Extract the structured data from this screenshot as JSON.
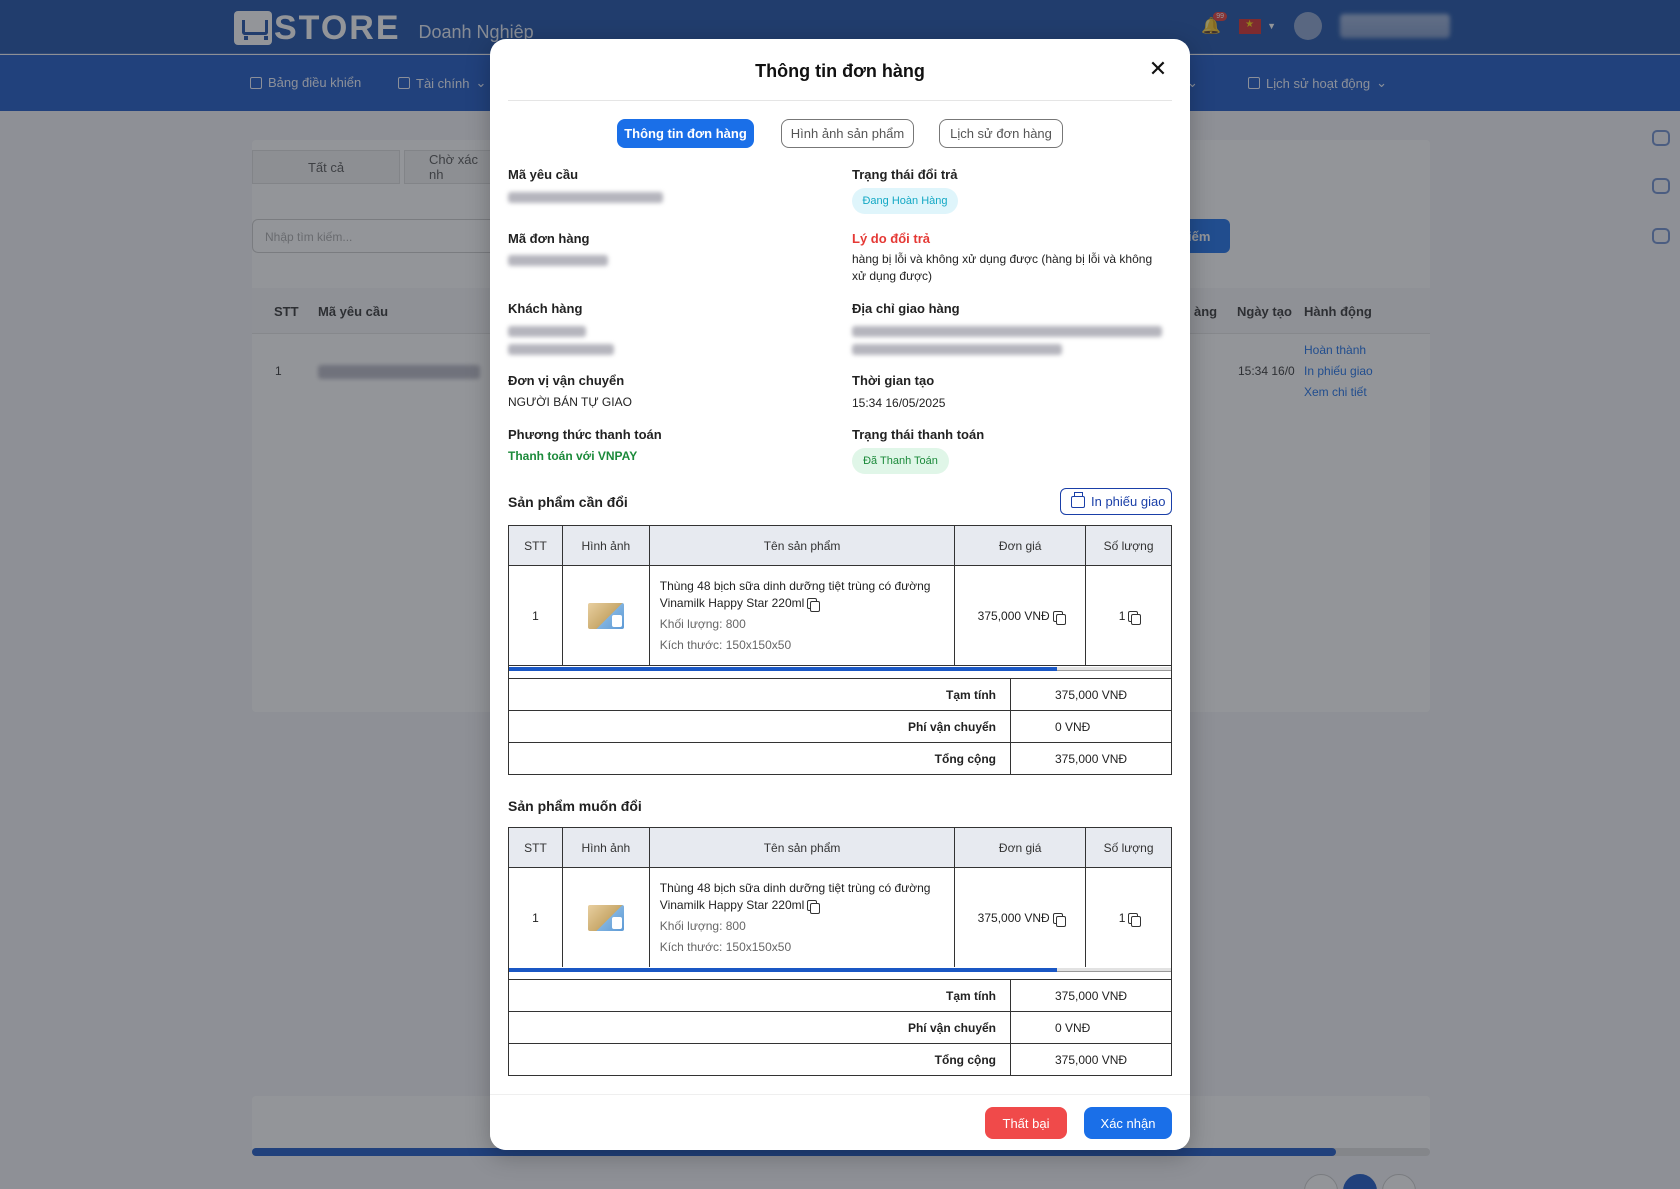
{
  "header": {
    "logo_text": "STORE",
    "logo_sub": "Doanh Nghiệp",
    "notif_count": "99"
  },
  "nav": {
    "dashboard": "Bảng điều khiển",
    "finance": "Tài chính",
    "history": "Lịch sử hoạt động"
  },
  "bg": {
    "tab_all": "Tất cả",
    "tab_pending": "Chờ xác nh",
    "search_placeholder": "Nhập tìm kiếm...",
    "search_btn": "iếm",
    "col_stt": "STT",
    "col_code": "Mã yêu cầu",
    "col_partial": "àng",
    "col_created": "Ngày tạo",
    "col_action": "Hành động",
    "row_stt": "1",
    "row_time": "15:34 16/0",
    "action_complete": "Hoàn thành",
    "action_print": "In phiếu giao",
    "action_detail": "Xem chi tiết",
    "page_current": "1",
    "scroll_fraction": 0.92
  },
  "modal": {
    "title": "Thông tin đơn hàng",
    "tabs": [
      "Thông tin đơn hàng",
      "Hình ảnh sản phẩm",
      "Lịch sử đơn hàng"
    ],
    "fields": {
      "request_code_label": "Mã yêu cầu",
      "request_code_value": "",
      "order_code_label": "Mã đơn hàng",
      "order_code_value": "",
      "customer_label": "Khách hàng",
      "customer_value": "",
      "shipping_unit_label": "Đơn vị vận chuyển",
      "shipping_unit_value": "NGƯỜI BÁN TỰ GIAO",
      "payment_method_label": "Phương thức thanh toán",
      "payment_method_value": "Thanh toán với VNPAY",
      "return_status_label": "Trạng thái đổi trả",
      "return_status_value": "Đang Hoàn Hàng",
      "return_reason_label": "Lý do đổi trả",
      "return_reason_value": "hàng bị lỗi và không xử dụng được (hàng bị lỗi và không xử dụng được)",
      "address_label": "Địa chỉ giao hàng",
      "address_value": "",
      "created_time_label": "Thời gian tạo",
      "created_time_value": "15:34 16/05/2025",
      "payment_status_label": "Trạng thái thanh toán",
      "payment_status_value": "Đã Thanh Toán"
    },
    "section_exchange": "Sản phẩm cần đổi",
    "section_wanted": "Sản phẩm muốn đổi",
    "print_btn": "In phiếu giao",
    "table_headers": [
      "STT",
      "Hình ảnh",
      "Tên sản phẩm",
      "Đơn giá",
      "Số lượng"
    ],
    "products_exchange": [
      {
        "stt": "1",
        "name": "Thùng 48 bịch sữa dinh dưỡng tiệt trùng có đường Vinamilk Happy Star 220ml",
        "weight": "Khối lượng: 800",
        "size": "Kích thước: 150x150x50",
        "price": "375,000 VNĐ",
        "qty": "1"
      }
    ],
    "products_wanted": [
      {
        "stt": "1",
        "name": "Thùng 48 bịch sữa dinh dưỡng tiệt trùng có đường Vinamilk Happy Star 220ml",
        "weight": "Khối lượng: 800",
        "size": "Kích thước: 150x150x50",
        "price": "375,000 VNĐ",
        "qty": "1"
      }
    ],
    "summary_exchange": {
      "subtotal_label": "Tạm tính",
      "subtotal": "375,000 VNĐ",
      "shipping_label": "Phí vận chuyển",
      "shipping": "0 VNĐ",
      "total_label": "Tổng cộng",
      "total": "375,000 VNĐ"
    },
    "summary_wanted": {
      "subtotal_label": "Tạm tính",
      "subtotal": "375,000 VNĐ",
      "shipping_label": "Phí vận chuyển",
      "shipping": "0 VNĐ",
      "total_label": "Tổng cộng",
      "total": "375,000 VNĐ"
    },
    "table_scroll_fraction": 0.828,
    "btn_fail": "Thất bại",
    "btn_confirm": "Xác nhận"
  }
}
